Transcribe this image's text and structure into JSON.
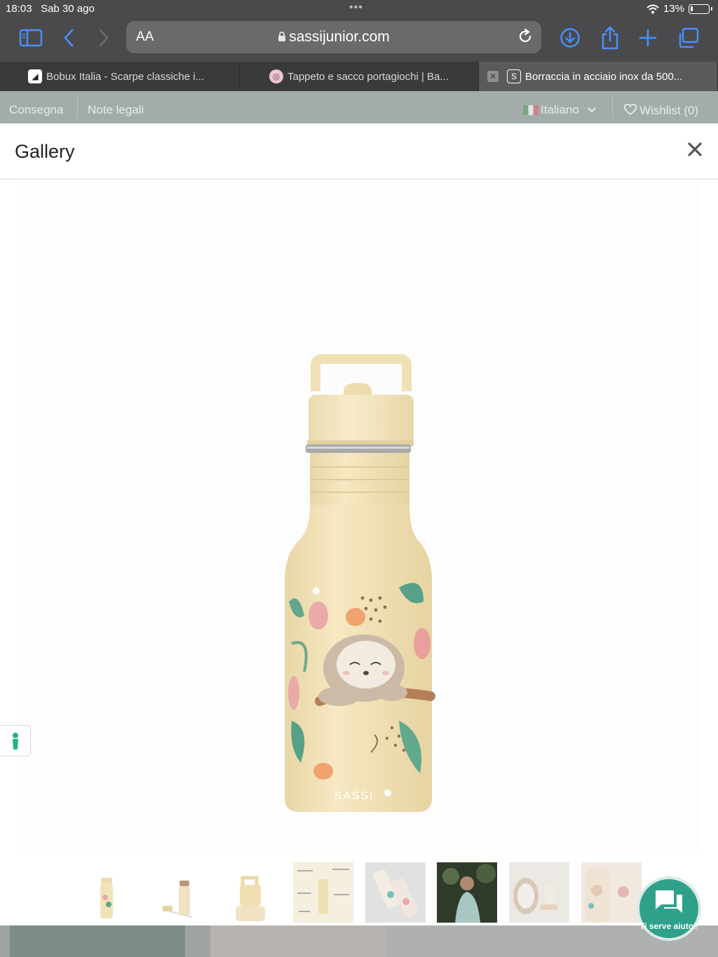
{
  "status_bar": {
    "time": "18:03",
    "date": "Sab 30 ago",
    "battery": "13%"
  },
  "browser": {
    "text_size_label": "AA",
    "url": "sassijunior.com",
    "tabs": [
      {
        "title": "Bobux Italia - Scarpe classiche i..."
      },
      {
        "title": "Tappeto e sacco portagiochi | Ba..."
      },
      {
        "title": "Borraccia in acciaio inox da 500..."
      }
    ]
  },
  "site_bar": {
    "links": [
      "Consegna",
      "Note legali"
    ],
    "language": "Italiano",
    "wishlist": "Wishlist (0)"
  },
  "gallery": {
    "title": "Gallery",
    "product_brand": "SASSI",
    "thumbnail_count": 8
  },
  "help": {
    "label": "Ti serve aiuto?"
  },
  "colors": {
    "bottle": "#f3e3b8",
    "cap": "#f0dfb4",
    "site_bar": "#a3acab",
    "help_bubble": "#2fa18a",
    "accent_blue": "#4a90ff"
  },
  "icons": [
    "sidebar-icon",
    "back-icon",
    "forward-icon",
    "lock-icon",
    "reload-icon",
    "download-icon",
    "share-icon",
    "new-tab-icon",
    "tabs-icon",
    "heart-icon",
    "close-icon",
    "chat-icon",
    "accessibility-icon"
  ]
}
